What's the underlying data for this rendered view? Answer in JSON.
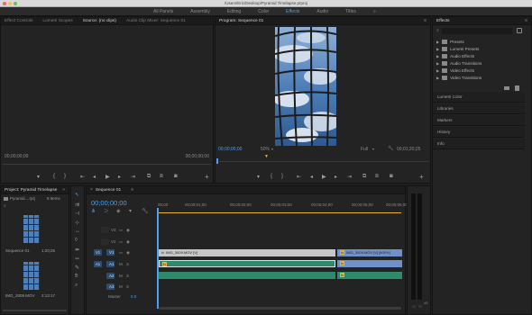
{
  "title": "/Users/Eric/Desktop/Pyramid Timelapse.prproj",
  "colors": {
    "accent": "#4a9ef2",
    "clip_video": "#c6c6c6",
    "clip_audio": "#2d8a6c",
    "clip_selected": "#6f90c8",
    "playhead": "#4a9ef2"
  },
  "workspace": {
    "items": [
      "All Panels",
      "Assembly",
      "Editing",
      "Color",
      "Effects",
      "Audio",
      "Titles"
    ],
    "active_index": 4,
    "more": "»"
  },
  "source_panel": {
    "tabs": [
      "Effect Controls",
      "Lumetri Scopes",
      "Source: (no clips)",
      "Audio Clip Mixer: Sequence 01"
    ],
    "active_tab": 2,
    "tc_left": "00;00;00;00",
    "tc_right": "00;00;00;00",
    "menu": "≡"
  },
  "program_panel": {
    "tab": "Program: Sequence 01",
    "menu": "≡",
    "tc_left": "00;00;00;00",
    "zoom": "50%",
    "quality": "Full",
    "tc_right": "00;01;20;25"
  },
  "effects_panel": {
    "tab": "Effects",
    "menu": "≡",
    "search_icon": "search-icon",
    "items": [
      {
        "label": "Presets",
        "icon": "folder-star"
      },
      {
        "label": "Lumetri Presets",
        "icon": "folder-star"
      },
      {
        "label": "Audio Effects",
        "icon": "folder"
      },
      {
        "label": "Audio Transitions",
        "icon": "folder"
      },
      {
        "label": "Video Effects",
        "icon": "folder"
      },
      {
        "label": "Video Transitions",
        "icon": "folder"
      }
    ],
    "sections": [
      "Lumetri Color",
      "Libraries",
      "Markers",
      "History",
      "Info"
    ]
  },
  "project_panel": {
    "tab": "Project: Pyramid Timelapse",
    "menu": "»",
    "file": "Pyramid....rprj",
    "count": "8 Items",
    "items": [
      {
        "name": "Sequence 01",
        "duration": "1:20;25"
      },
      {
        "name": "IMG_3009.MOV",
        "duration": "2:13:17"
      }
    ]
  },
  "timeline": {
    "tab": "Sequence 01",
    "menu": "≡",
    "timecode": "00;00;00;00",
    "ruler": [
      "00;00",
      "00;00;01;00",
      "00;00;02;00",
      "00;00;03;00",
      "00;00;04;00",
      "00;00;05;00",
      "00;00;06;00"
    ],
    "video_tracks": [
      "V3",
      "V2",
      "V1"
    ],
    "audio_tracks": [
      "A1",
      "A2",
      "A3"
    ],
    "master": {
      "label": "Master",
      "value": "0.0"
    },
    "clips": {
      "v1_a": "IMG_3009.MOV [V]",
      "v1_b": "IMG_3009.MOV [V] [600%]"
    },
    "meter_db": "dB"
  }
}
